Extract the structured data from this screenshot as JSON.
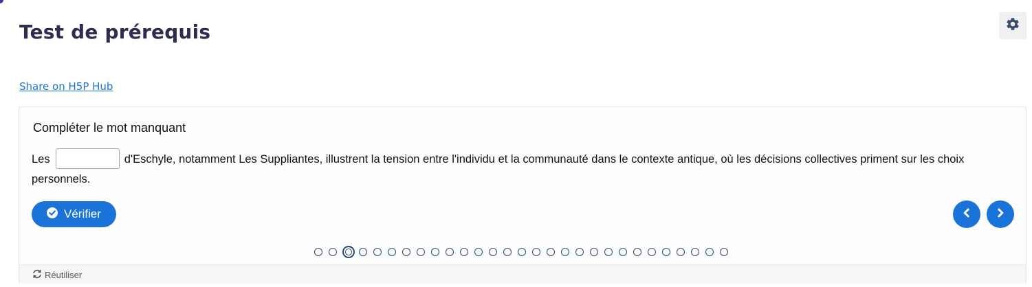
{
  "header": {
    "title": "Test de prérequis",
    "settings_icon": "gear-icon"
  },
  "share": {
    "label": "Share on H5P Hub"
  },
  "question": {
    "title": "Compléter le mot manquant",
    "text_before": "Les",
    "blank_value": "",
    "text_after": "d'Eschyle, notamment Les Suppliantes, illustrent la tension entre l'individu et la communauté dans le contexte antique, où les décisions collectives priment sur les choix personnels."
  },
  "actions": {
    "check_label": "Vérifier",
    "check_icon": "check-circle-icon",
    "prev_icon": "chevron-left-icon",
    "next_icon": "chevron-right-icon"
  },
  "progress": {
    "total": 29,
    "current": 3
  },
  "footer": {
    "reuse_label": "Réutiliser",
    "reuse_icon": "refresh-icon"
  },
  "colors": {
    "accent": "#1a73d9",
    "title": "#2d2d4f",
    "dot": "#2a4a7a"
  }
}
